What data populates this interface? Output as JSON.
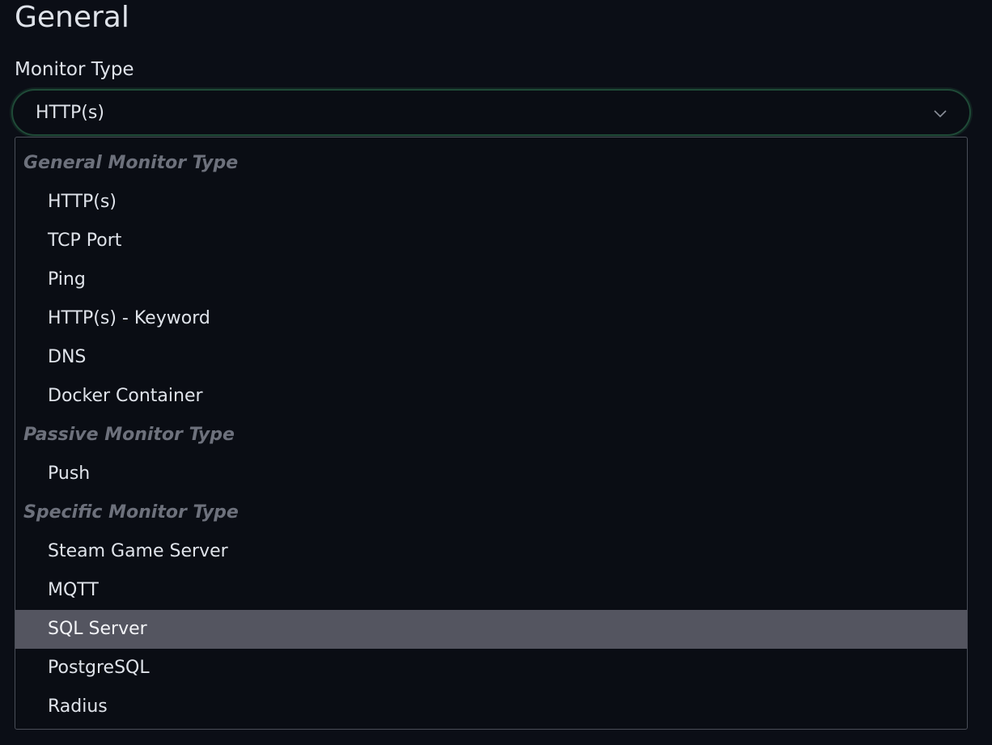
{
  "section": {
    "title": "General"
  },
  "monitor_type": {
    "label": "Monitor Type",
    "selected_value": "HTTP(s)",
    "chevron_icon": "chevron-down-icon"
  },
  "dropdown": {
    "groups": [
      {
        "label": "General Monitor Type",
        "options": [
          "HTTP(s)",
          "TCP Port",
          "Ping",
          "HTTP(s) - Keyword",
          "DNS",
          "Docker Container"
        ]
      },
      {
        "label": "Passive Monitor Type",
        "options": [
          "Push"
        ]
      },
      {
        "label": "Specific Monitor Type",
        "options": [
          "Steam Game Server",
          "MQTT",
          "SQL Server",
          "PostgreSQL",
          "Radius"
        ]
      }
    ],
    "highlighted_option": "SQL Server"
  },
  "colors": {
    "background": "#0b0e16",
    "focus_ring": "#1f4a37",
    "highlight": "#545560",
    "group_label": "#6d717c"
  }
}
